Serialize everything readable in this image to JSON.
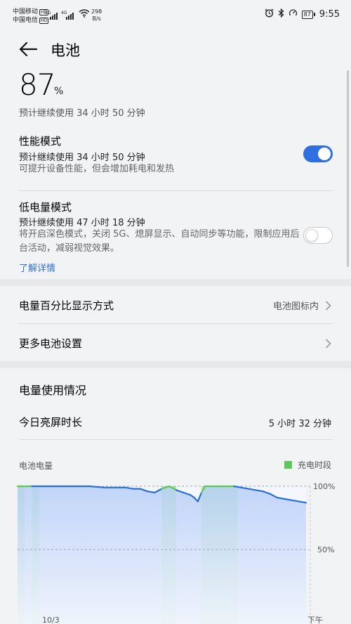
{
  "status_bar": {
    "carrier1": "中国移动",
    "carrier2": "中国电信",
    "hd_badge": "HD",
    "gen1": "5G",
    "gen2": "4G",
    "speed_value": "298",
    "speed_unit": "B/s",
    "battery_level": "87",
    "time": "9:55",
    "icons": [
      "alarm-icon",
      "bluetooth-icon",
      "do-not-disturb-icon"
    ]
  },
  "header": {
    "title": "电池"
  },
  "battery": {
    "percent": "87",
    "unit": "%",
    "remaining": "预计继续使用 34 小时 50 分钟"
  },
  "performance_mode": {
    "title": "性能模式",
    "estimate": "预计继续使用 34 小时 50 分钟",
    "description": "可提升设备性能，但会增加耗电和发热",
    "enabled": true
  },
  "power_saving_mode": {
    "title": "低电量模式",
    "estimate": "预计继续使用 47 小时 18 分钟",
    "description": "将开启深色模式，关闭 5G、熄屏显示、自动同步等功能，限制应用后台活动，减弱视觉效果。",
    "enabled": false,
    "learn_more": "了解详情"
  },
  "settings": {
    "percentage_display": {
      "label": "电量百分比显示方式",
      "value": "电池图标内"
    },
    "more_settings": {
      "label": "更多电池设置"
    }
  },
  "usage": {
    "section_title": "电量使用情况",
    "screen_time_label": "今日亮屏时长",
    "screen_time_value": "5 小时 32 分钟",
    "chart_label": "电池电量",
    "legend_charging": "充电时段"
  },
  "colors": {
    "accent": "#2f6fdf",
    "line": "#2a6fd4",
    "charging": "#5ac85a"
  },
  "chart_data": {
    "type": "area",
    "ylabel_ticks": [
      "100%",
      "50%"
    ],
    "ylim": [
      0,
      100
    ],
    "x_tick_labels": [
      "10/3",
      "下午"
    ],
    "series": [
      {
        "name": "电池电量",
        "x": [
          0,
          2,
          4,
          6,
          8,
          10,
          12,
          14,
          15,
          16,
          17,
          18,
          19,
          20,
          21,
          22,
          23,
          24,
          24.5,
          25,
          25.5,
          26,
          27,
          28,
          29,
          30,
          31,
          32,
          33,
          34,
          35,
          36,
          37,
          38,
          39,
          40
        ],
        "values": [
          100,
          100,
          100,
          100,
          100,
          100,
          99,
          99,
          99,
          98,
          98,
          96,
          95,
          98,
          100,
          97,
          95,
          93,
          91,
          88,
          95,
          100,
          100,
          100,
          100,
          100,
          99,
          98,
          97,
          96,
          94,
          91,
          90,
          89,
          88,
          87
        ]
      }
    ],
    "charging_periods": [
      [
        0,
        1
      ],
      [
        2,
        3
      ],
      [
        20,
        22
      ],
      [
        25.5,
        30.5
      ]
    ]
  }
}
